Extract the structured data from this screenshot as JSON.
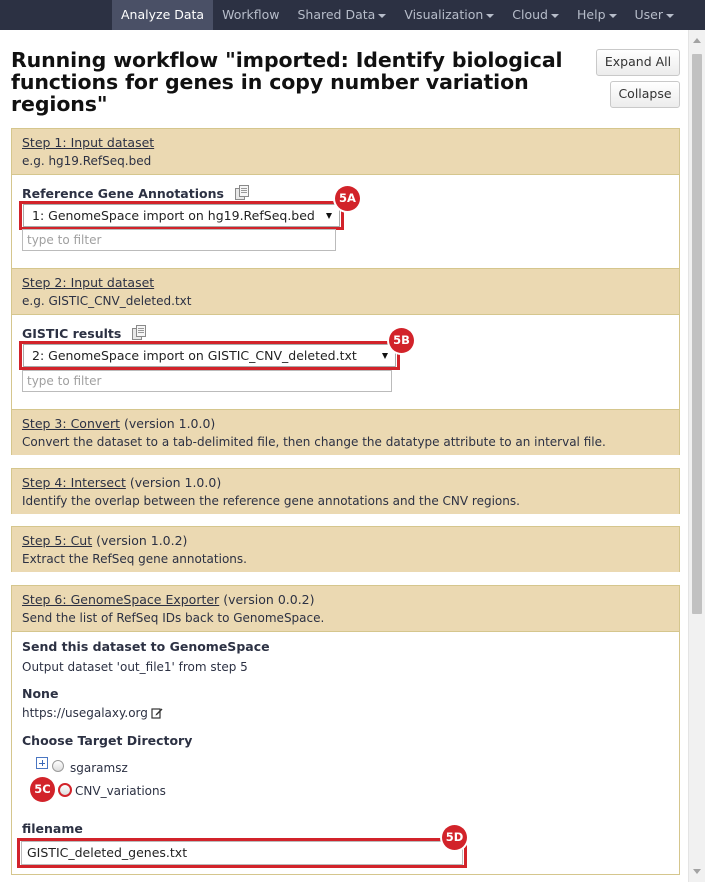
{
  "nav": {
    "items": [
      {
        "label": "Analyze Data",
        "active": true,
        "dropdown": false
      },
      {
        "label": "Workflow",
        "active": false,
        "dropdown": false
      },
      {
        "label": "Shared Data",
        "active": false,
        "dropdown": true
      },
      {
        "label": "Visualization",
        "active": false,
        "dropdown": true
      },
      {
        "label": "Cloud",
        "active": false,
        "dropdown": true
      },
      {
        "label": "Help",
        "active": false,
        "dropdown": true
      },
      {
        "label": "User",
        "active": false,
        "dropdown": true
      }
    ]
  },
  "page": {
    "title": "Running workflow \"imported: Identify biological functions for genes in copy number variation regions\"",
    "expand_all": "Expand All",
    "collapse": "Collapse"
  },
  "steps": [
    {
      "title": "Step 1: Input dataset",
      "desc": "e.g. hg19.RefSeq.bed",
      "field_label": "Reference Gene Annotations",
      "select_value": "1: GenomeSpace import on hg19.RefSeq.bed",
      "filter_placeholder": "type to filter",
      "badge": "5A"
    },
    {
      "title": "Step 2: Input dataset",
      "desc": "e.g. GISTIC_CNV_deleted.txt",
      "field_label": "GISTIC results",
      "select_value": "2: GenomeSpace import on GISTIC_CNV_deleted.txt",
      "filter_placeholder": "type to filter",
      "badge": "5B"
    },
    {
      "title": "Step 3: Convert",
      "version": "(version 1.0.0)",
      "desc": "Convert the dataset to a tab-delimited file, then change the datatype attribute to an interval file."
    },
    {
      "title": "Step 4: Intersect",
      "version": "(version 1.0.0)",
      "desc": "Identify the overlap between the reference gene annotations and the CNV regions."
    },
    {
      "title": "Step 5: Cut",
      "version": "(version 1.0.2)",
      "desc": "Extract the RefSeq gene annotations."
    },
    {
      "title": "Step 6: GenomeSpace Exporter",
      "version": "(version 0.0.2)",
      "desc": "Send the list of RefSeq IDs back to GenomeSpace.",
      "send_title": "Send this dataset to GenomeSpace",
      "send_value": "Output dataset 'out_file1' from step 5",
      "none_title": "None",
      "url": "https://usegalaxy.org",
      "choose_title": "Choose Target Directory",
      "dir_root": "sgaramsz",
      "dir_child": "CNV_variations",
      "badge_dir": "5C",
      "filename_label": "filename",
      "filename_value": "GISTIC_deleted_genes.txt",
      "badge_filename": "5D"
    }
  ]
}
